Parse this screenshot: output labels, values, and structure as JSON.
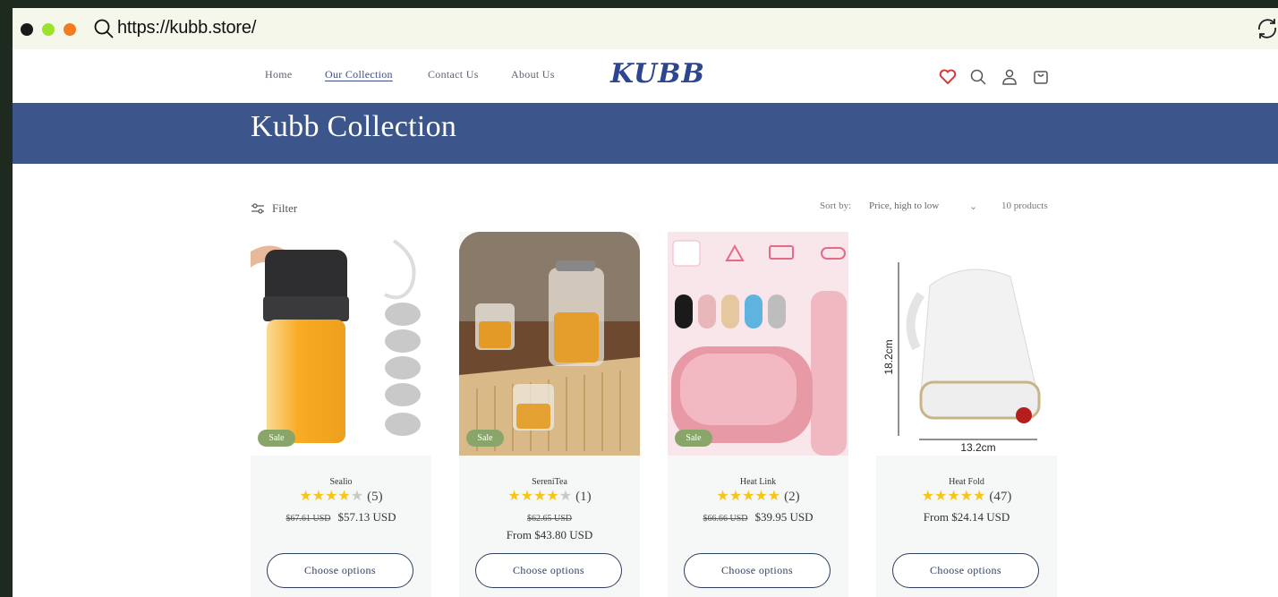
{
  "browser": {
    "url": "https://kubb.store/"
  },
  "nav": {
    "links": [
      "Home",
      "Our Collection",
      "Contact Us",
      "About Us"
    ],
    "logo": "KUBB"
  },
  "banner": {
    "title": "Kubb Collection"
  },
  "toolbar": {
    "filter_label": "Filter",
    "sort_label": "Sort by:",
    "sort_value": "Price, high to low",
    "product_count": "10 products"
  },
  "products": [
    {
      "name": "Sealio",
      "rating": 4,
      "reviews": "(5)",
      "badge": "Sale",
      "compare_price": "$67.61 USD",
      "price": "$57.13 USD",
      "button": "Choose options"
    },
    {
      "name": "SereniTea",
      "rating": 4,
      "reviews": "(1)",
      "badge": "Sale",
      "compare_price": "$62.65 USD",
      "price": "From $43.80 USD",
      "button": "Choose options"
    },
    {
      "name": "Heat Link",
      "rating": 5,
      "reviews": "(2)",
      "badge": "Sale",
      "compare_price": "$66.66 USD",
      "price": "$39.95 USD",
      "button": "Choose options"
    },
    {
      "name": "Heat Fold",
      "rating": 5,
      "reviews": "(47)",
      "badge": "",
      "compare_price": "",
      "price": "From $24.14 USD",
      "button": "Choose options",
      "image_labels": [
        "18.2cm",
        "13.2cm"
      ]
    }
  ],
  "colors": {
    "banner": "#3c558b",
    "logo": "#2c4692",
    "sale_badge": "#8aa569",
    "star": "#f5c518",
    "heart": "#d63a3a"
  }
}
